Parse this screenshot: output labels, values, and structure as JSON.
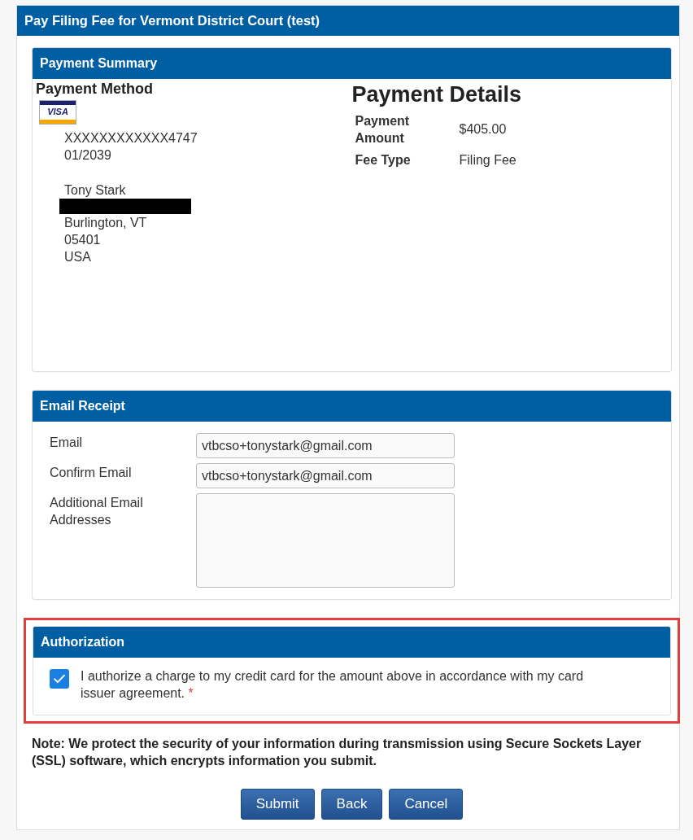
{
  "page_title": "Pay Filing Fee for Vermont District Court (test)",
  "payment_summary": {
    "title": "Payment Summary",
    "payment_method": {
      "heading": "Payment Method",
      "card_brand": "VISA",
      "card_number": "XXXXXXXXXXXX4747",
      "expiry": "01/2039",
      "address_lines": [
        "Tony Stark",
        "Burlington, VT",
        "05401",
        "USA"
      ]
    },
    "payment_details": {
      "heading": "Payment Details",
      "rows": [
        {
          "label": "Payment Amount",
          "value": "$405.00"
        },
        {
          "label": "Fee Type",
          "value": "Filing Fee"
        }
      ]
    }
  },
  "email_receipt": {
    "title": "Email Receipt",
    "fields": [
      {
        "kind": "input",
        "label": "Email",
        "value": "vtbcso+tonystark@gmail.com"
      },
      {
        "kind": "input",
        "label": "Confirm Email",
        "value": "vtbcso+tonystark@gmail.com"
      },
      {
        "kind": "textarea",
        "label": "Additional Email Addresses"
      }
    ]
  },
  "authorization": {
    "title": "Authorization",
    "highlighted": true,
    "checked": true,
    "text": "I authorize a charge to my credit card for the amount above in accordance with my card issuer agreement.",
    "required_mark": "*"
  },
  "note": "Note: We protect the security of your information during transmission using Secure Sockets Layer (SSL) software, which encrypts information you submit.",
  "buttons": [
    "Submit",
    "Back",
    "Cancel"
  ]
}
